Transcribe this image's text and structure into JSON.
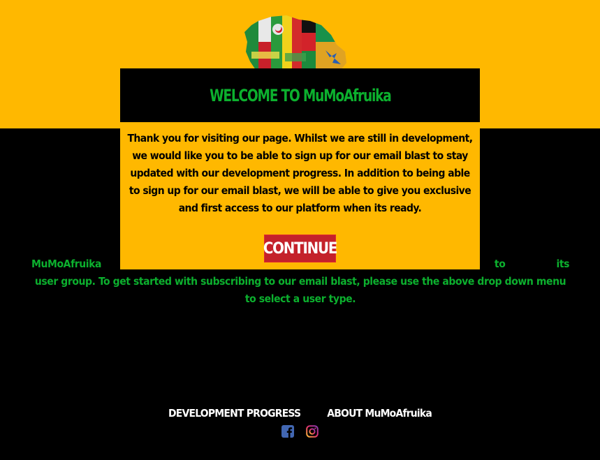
{
  "colors": {
    "brand_yellow": "#FFB800",
    "brand_green": "#0CB02E",
    "continue_red": "#C4212A",
    "background": "#000000"
  },
  "modal": {
    "title": "WELCOME TO MuMoAfruika",
    "body": "Thank you for visiting our page. Whilst we are still in development, we would like you to be able to sign up for our email blast to stay updated with our development progress. In addition to being able to sign up for our email blast, we will be able to give you exclusive and first access to our platform when its ready.",
    "continue_label": "CONTINUE"
  },
  "main": {
    "line1_left": "MuMoAfruika will b",
    "line1_right": "s that tailor it to its",
    "rest": "user group. To get started with subscribing to our email blast, please use the above drop down menu to select a user type."
  },
  "footer": {
    "link_progress": "DEVELOPMENT PROGRESS",
    "link_about": "ABOUT MuMoAfruika"
  },
  "icons": {
    "logo": "africa-map-flags-logo",
    "facebook": "facebook-icon",
    "instagram": "instagram-icon"
  }
}
